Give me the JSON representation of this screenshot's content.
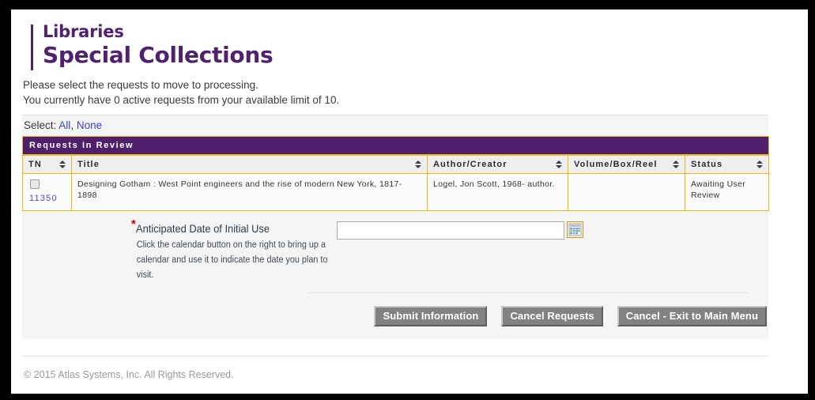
{
  "branding": {
    "line1": "Libraries",
    "line2": "Special Collections",
    "accent_color": "#4f2170"
  },
  "intro": {
    "line1": "Please select the requests to move to processing.",
    "line2": "You currently have 0 active requests from your available limit of 10."
  },
  "select_bar": {
    "label": "Select:",
    "all_label": "All",
    "separator": ",",
    "none_label": "None",
    "link_color": "#3b44c4"
  },
  "table": {
    "caption": "Requests In Review",
    "caption_bg": "#4f1f6e",
    "border_color": "#f0b90f",
    "columns": [
      {
        "label": "TN",
        "sortable": true
      },
      {
        "label": "Title",
        "sortable": true
      },
      {
        "label": "Author/Creator",
        "sortable": true
      },
      {
        "label": "Volume/Box/Reel",
        "sortable": true
      },
      {
        "label": "Status",
        "sortable": true
      }
    ],
    "rows": [
      {
        "checked": false,
        "tn": "11350",
        "title": "Designing Gotham : West Point engineers and the rise of modern New York, 1817-1898",
        "author": "Logel, Jon Scott, 1968- author.",
        "volume": "",
        "status": "Awaiting User Review"
      }
    ]
  },
  "form": {
    "required_marker": "*",
    "date_label": "Anticipated Date of Initial Use",
    "date_help": "Click the calendar button on the right to bring up a calendar and use it to indicate the date you plan to visit.",
    "date_value": "",
    "date_placeholder": "",
    "calendar_icon": "calendar-icon"
  },
  "buttons": {
    "submit": "Submit Information",
    "cancel_requests": "Cancel Requests",
    "cancel_exit": "Cancel - Exit to Main Menu"
  },
  "footer": {
    "copyright": "© 2015 Atlas Systems, Inc. All Rights Reserved."
  }
}
